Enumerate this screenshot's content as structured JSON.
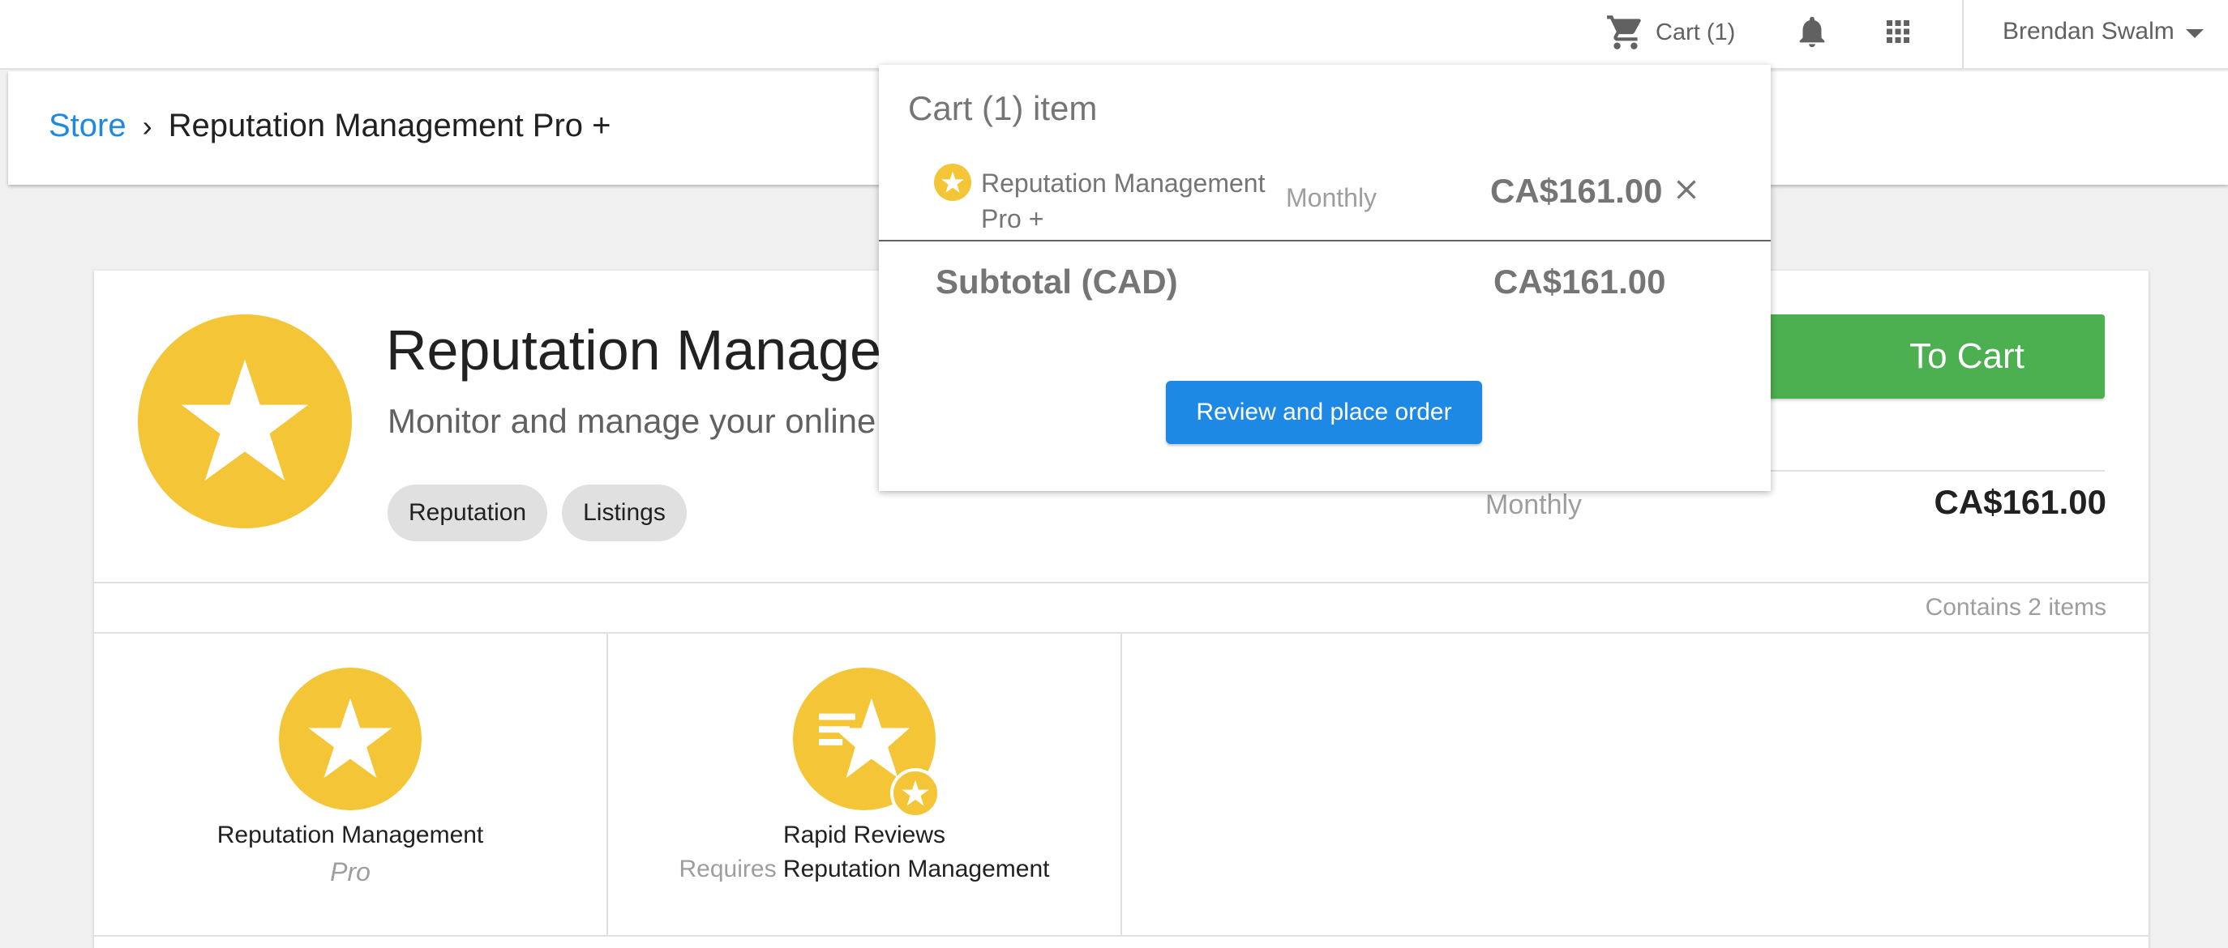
{
  "topbar": {
    "cart_label": "Cart (1)",
    "user_name": "Brendan Swalm",
    "icons": {
      "cart": "cart-icon",
      "notifications": "bell-icon",
      "apps": "apps-grid-icon",
      "user_menu": "chevron-down-icon"
    }
  },
  "breadcrumb": {
    "root": "Store",
    "separator": "›",
    "current": "Reputation Management Pro +"
  },
  "product": {
    "title": "Reputation Management Pro +",
    "description": "Monitor and manage your online reputation",
    "tags": [
      "Reputation",
      "Listings"
    ],
    "add_to_cart_label": "To Cart",
    "billing_cycle": "Monthly",
    "price": "CA$161.00",
    "contains_text": "Contains 2 items",
    "accent_color": "#f3c537"
  },
  "included_items": [
    {
      "name": "Reputation Management",
      "subtitle": "Pro"
    },
    {
      "name": "Rapid Reviews",
      "requires_label": "Requires",
      "requires_product": "Reputation Management"
    }
  ],
  "cart_dropdown": {
    "title": "Cart (1) item",
    "item": {
      "name": "Reputation Management Pro +",
      "billing_cycle": "Monthly",
      "price": "CA$161.00"
    },
    "subtotal_label": "Subtotal (CAD)",
    "subtotal_value": "CA$161.00",
    "review_button": "Review and place order"
  }
}
